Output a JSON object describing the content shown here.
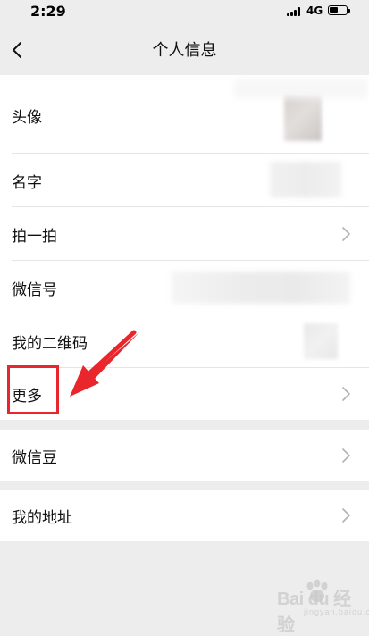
{
  "status_bar": {
    "time": "2:29",
    "network": "4G"
  },
  "nav": {
    "title": "个人信息"
  },
  "rows": [
    {
      "label": "头像"
    },
    {
      "label": "名字"
    },
    {
      "label": "拍一拍"
    },
    {
      "label": "微信号"
    },
    {
      "label": "我的二维码"
    },
    {
      "label": "更多"
    },
    {
      "label": "微信豆"
    },
    {
      "label": "我的地址"
    }
  ],
  "watermark": {
    "brand": "Bai du 经验",
    "sub": "jingyan.baidu.com"
  },
  "colors": {
    "page_background": "#ededed",
    "card_background": "#ffffff",
    "annotation_red": "#e8262c"
  },
  "icons": {
    "back": "chevron-left-icon",
    "row_arrow": "chevron-right-icon",
    "signal": "cellular-signal-icon",
    "battery": "battery-icon"
  }
}
